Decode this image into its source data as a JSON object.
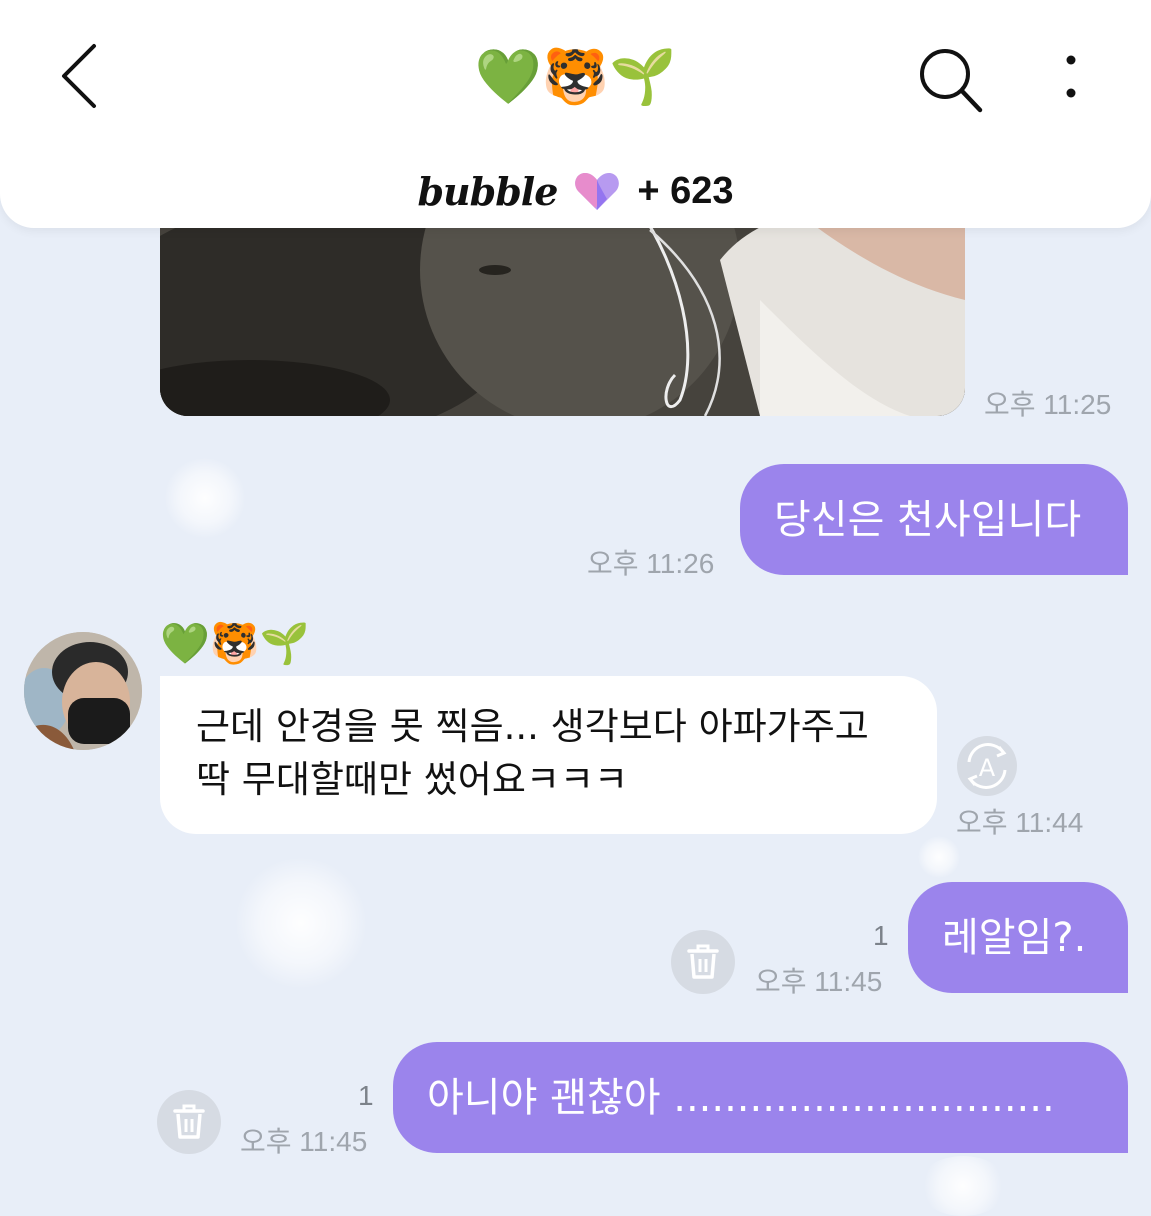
{
  "header": {
    "title": "💚🐯🌱",
    "brand": "bubble",
    "subscriber_count": "+ 623"
  },
  "messages": [
    {
      "type": "image",
      "time": "오후 11:25"
    },
    {
      "type": "outgoing",
      "text": "당신은 천사입니다",
      "time": "오후 11:26"
    },
    {
      "type": "incoming",
      "sender": "💚🐯🌱",
      "text": "근데 안경을 못 찍음... 생각보다 아파가주고 딱 무대할때만 썼어요ㅋㅋㅋ",
      "time": "오후 11:44"
    },
    {
      "type": "outgoing",
      "text": "레알임?.",
      "time": "오후 11:45",
      "unread": "1"
    },
    {
      "type": "outgoing",
      "text": "아니야 괜찮아 ..............................",
      "time": "오후 11:45",
      "unread": "1"
    }
  ],
  "icons": {
    "back": "chevron-left-icon",
    "search": "search-icon",
    "more": "more-vertical-icon",
    "translate": "translate-icon",
    "delete": "trash-icon",
    "brand_logo": "bubble-heart-icon"
  },
  "colors": {
    "outgoing_bubble": "#9b84ec",
    "incoming_bubble": "#ffffff",
    "background": "#e8eef8",
    "timestamp": "#9fa5ad"
  }
}
